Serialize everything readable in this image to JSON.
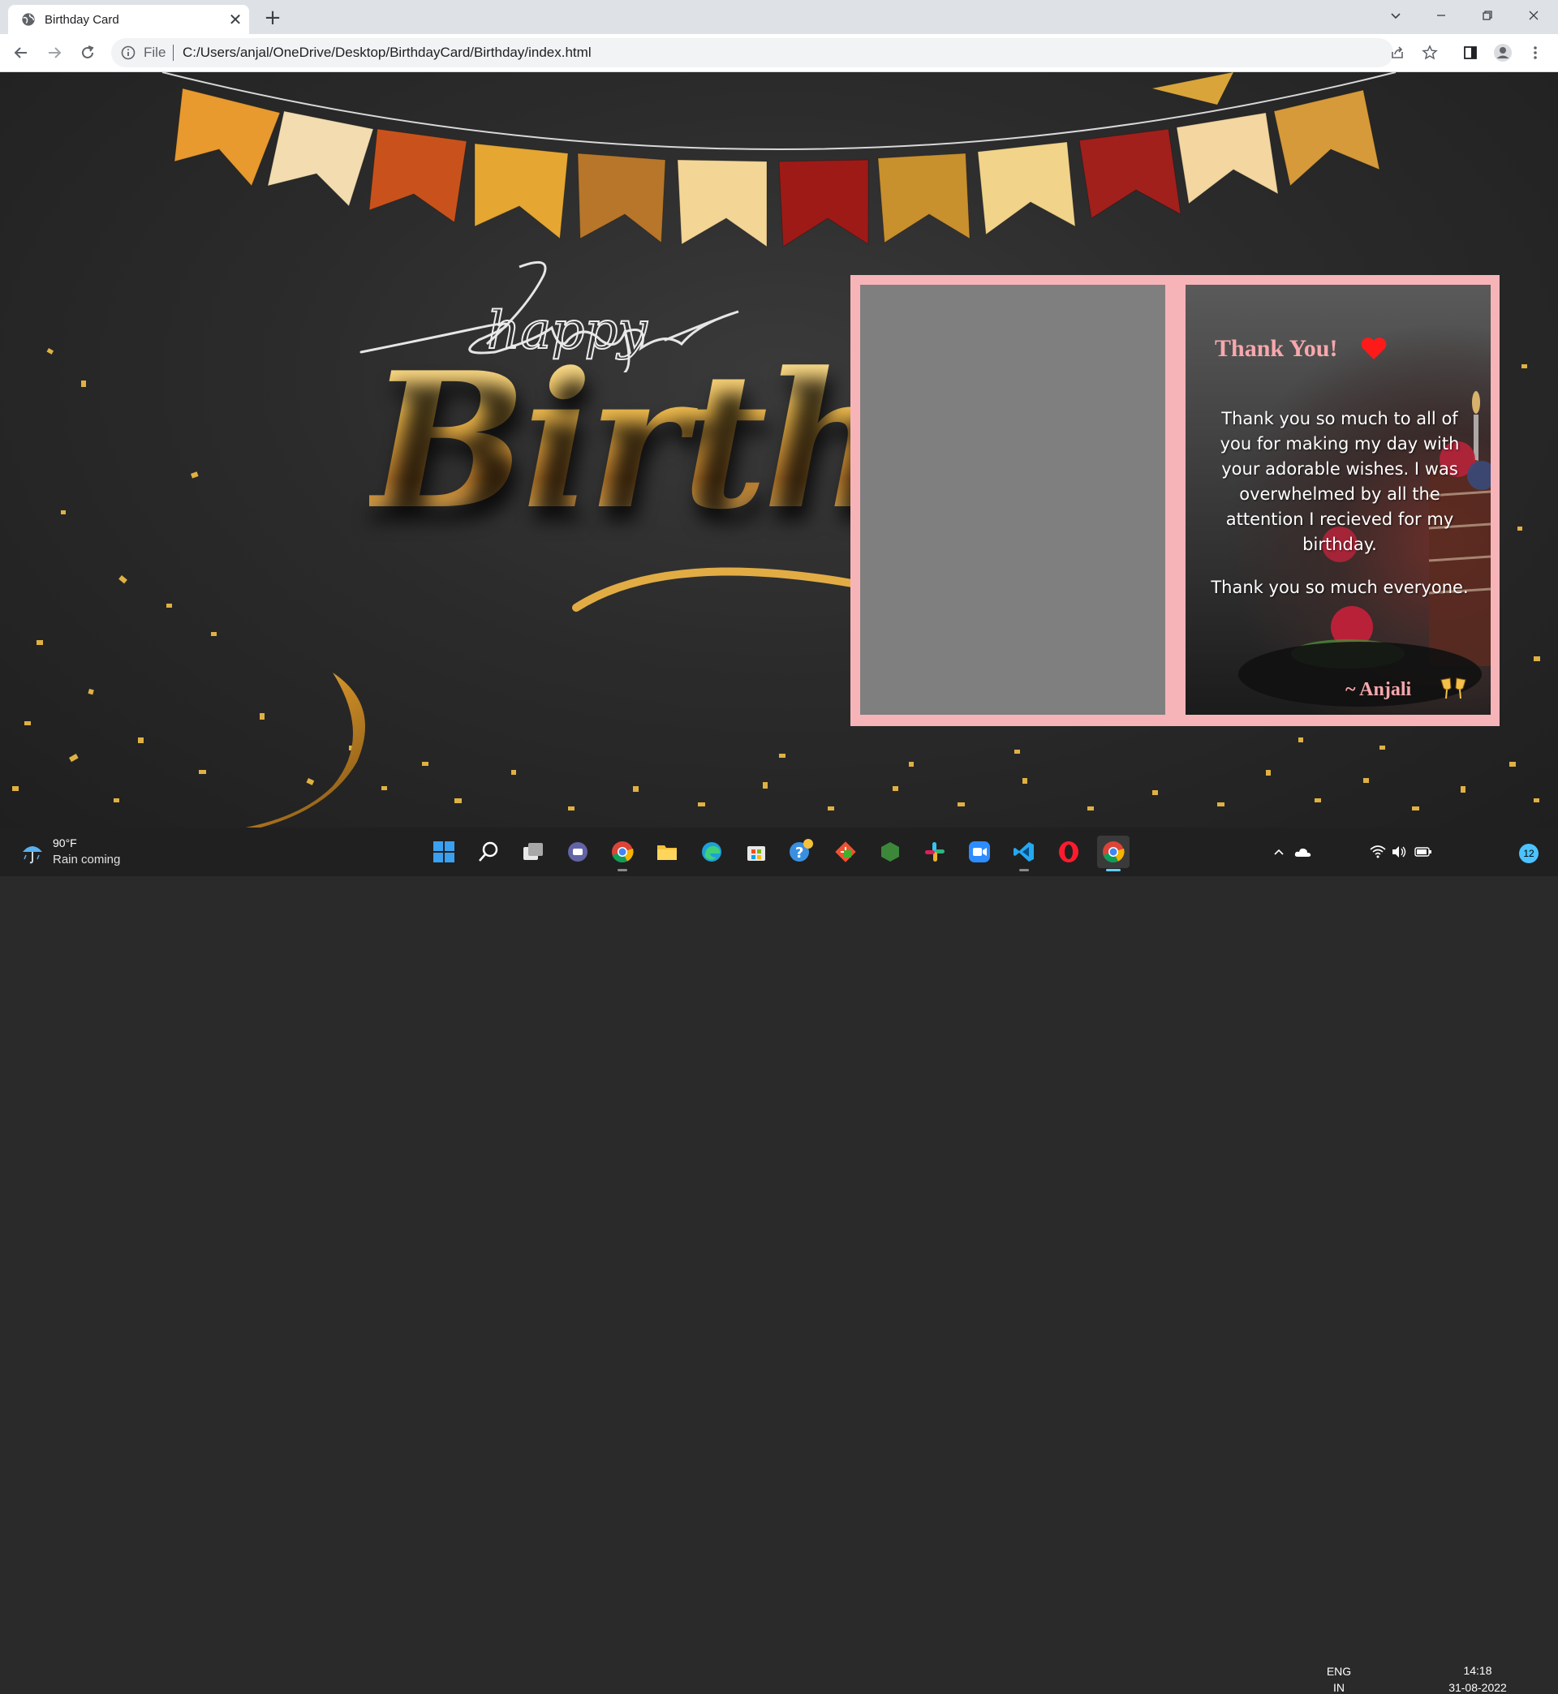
{
  "browser": {
    "tab_title": "Birthday Card",
    "omnibox_scheme": "File",
    "url": "C:/Users/anjal/OneDrive/Desktop/BirthdayCard/Birthday/index.html"
  },
  "page": {
    "happy_text": "happy",
    "birthday_text": "Birthday"
  },
  "card": {
    "heading": "Thank You!",
    "message_p1": "Thank you so much to all of you for making my day with your adorable wishes. I was overwhelmed by all the attention I recieved for my birthday.",
    "message_p2": "Thank you so much everyone.",
    "signature": "~ Anjali",
    "border_color": "#f6b4b8",
    "heading_color": "#f7a8ad"
  },
  "taskbar": {
    "weather_temp": "90°F",
    "weather_desc": "Rain coming",
    "lang_top": "ENG",
    "lang_bottom": "IN",
    "time": "14:18",
    "date": "31-08-2022",
    "notifications": "12",
    "apps": [
      "start-icon",
      "search-icon",
      "task-view-icon",
      "teams-icon",
      "chrome-icon",
      "file-explorer-icon",
      "edge-icon",
      "store-icon",
      "get-help-icon",
      "git-icon",
      "nodejs-icon",
      "slack-icon",
      "zoom-icon",
      "vscode-icon",
      "opera-icon",
      "chrome-active-icon"
    ]
  }
}
